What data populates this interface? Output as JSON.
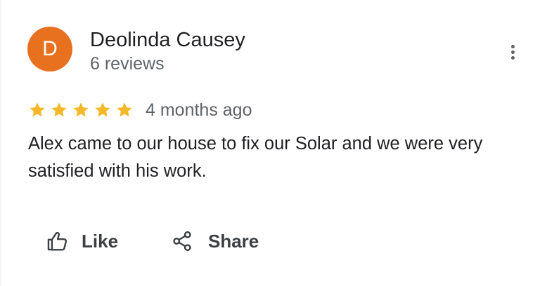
{
  "review": {
    "author": {
      "initial": "D",
      "name": "Deolinda Causey",
      "review_count": "6 reviews",
      "avatar_color": "#e8711f"
    },
    "rating": 5,
    "rating_max": 5,
    "star_color": "#f5b829",
    "date": "4 months ago",
    "text": "Alex came to our house to fix our Solar and we were very satisfied with his work.",
    "more_icon": "more-vert-icon"
  },
  "actions": {
    "like_label": "Like",
    "like_icon": "thumb-up-icon",
    "share_label": "Share",
    "share_icon": "share-icon"
  }
}
